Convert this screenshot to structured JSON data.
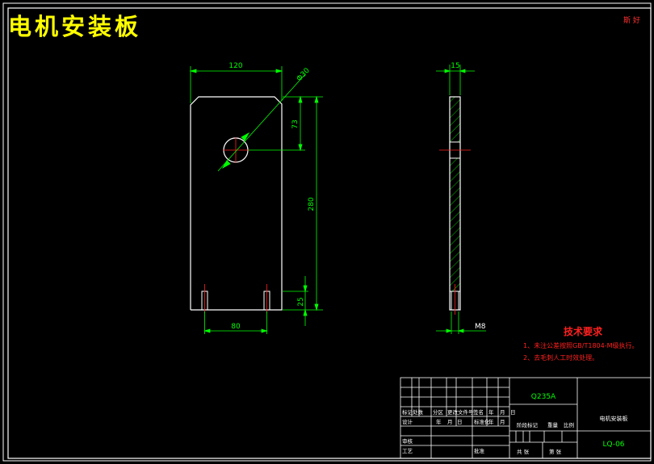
{
  "drawing": {
    "title": "电机安装板",
    "corner_mark": "斯 好",
    "dims": {
      "width_top": "120",
      "hole_dia": "Φ30",
      "hole_offset": "73",
      "height": "280",
      "slot_height": "25",
      "slot_spacing": "80",
      "thickness": "15",
      "thread": "M8"
    }
  },
  "tech": {
    "title": "技术要求",
    "line1": "1、未注公差按照GB/T1804-M级执行。",
    "line2": "2、去毛刺人工时效处理。"
  },
  "titleblock": {
    "material": "Q235A",
    "part_name": "电机安装板",
    "drawing_no": "LQ-06",
    "row_headers": [
      "标记",
      "处数",
      "分区",
      "更改文件号",
      "签名",
      "年",
      "月",
      "日"
    ],
    "design": "设计",
    "standardize": "标准化",
    "stage_mark": "阶段标记",
    "weight": "重量",
    "scale": "比例",
    "review": "审核",
    "process": "工艺",
    "approve": "批准",
    "sheets": "共 张",
    "sheet_no": "第 张",
    "ymd": [
      "年",
      "月",
      "日"
    ]
  },
  "colors": {
    "outline": "#ffffff",
    "dimension": "#00ff00",
    "center": "#ff2020",
    "title": "#ffff00",
    "hatch": "#00ff00"
  }
}
